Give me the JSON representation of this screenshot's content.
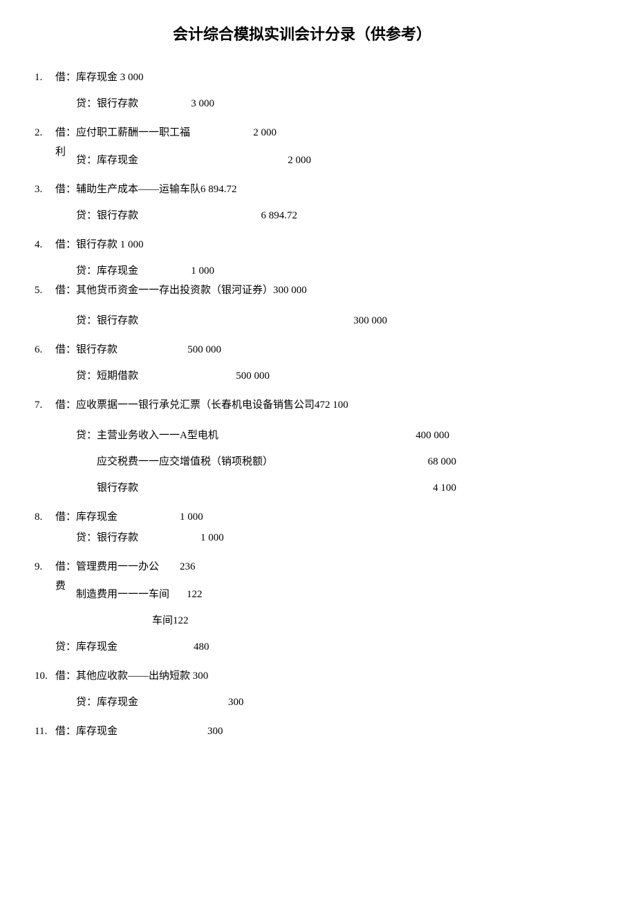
{
  "title": "会计综合模拟实训会计分录（供参考）",
  "entries": {
    "1": {
      "num": "1.",
      "dr": "借：库存现金  3 000",
      "cr": "贷：银行存款",
      "crAmt": "3 000"
    },
    "2": {
      "num": "2.",
      "dr": "借：应付职工薪酬一一职工福",
      "drAmt": "2 000",
      "note": "利",
      "cr": "贷：库存现金",
      "crAmt": "2 000"
    },
    "3": {
      "num": "3.",
      "dr": "借：辅助生产成本——运输车队6 894.72",
      "cr": "贷：银行存款",
      "crAmt": "6 894.72"
    },
    "4": {
      "num": "4.",
      "dr": "借：银行存款  1 000",
      "cr": "贷：库存现金",
      "crAmt": "1 000"
    },
    "5": {
      "num": "5.",
      "dr": "借：其他货币资金一一存出投资款（银河证券）300 000",
      "cr": "贷：银行存款",
      "crAmt": "300 000"
    },
    "6": {
      "num": "6.",
      "dr": "借：银行存款",
      "drAmt": "500 000",
      "cr": "贷：短期借款",
      "crAmt": "500 000"
    },
    "7": {
      "num": "7.",
      "dr": "借：应收票据一一银行承兑汇票（长春机电设备销售公司472 100",
      "cr1": "贷：主营业务收入一一A型电机",
      "cr1Amt": "400 000",
      "cr2": "应交税费一一应交增值税（销项税额）",
      "cr2Amt": "68 000",
      "cr3": "银行存款",
      "cr3Amt": "4 100"
    },
    "8": {
      "num": "8.",
      "dr": "借：库存现金",
      "drAmt": "1 000",
      "cr": "贷：银行存款",
      "crAmt": "1 000"
    },
    "9": {
      "num": "9.",
      "dr": "借：管理费用一一办公",
      "drAmt": "236",
      "note": "费",
      "dr2": "制造费用一一一车间",
      "dr2Amt": "122",
      "dr3": "车间",
      "dr3Amt": "122",
      "cr": "贷：库存现金",
      "crAmt": "480"
    },
    "10": {
      "num": "10.",
      "dr": "借：其他应收款——出纳短款  300",
      "cr": "贷：库存现金",
      "crAmt": "300"
    },
    "11": {
      "num": "11.",
      "dr": "借：库存现金",
      "drAmt": "300"
    }
  }
}
